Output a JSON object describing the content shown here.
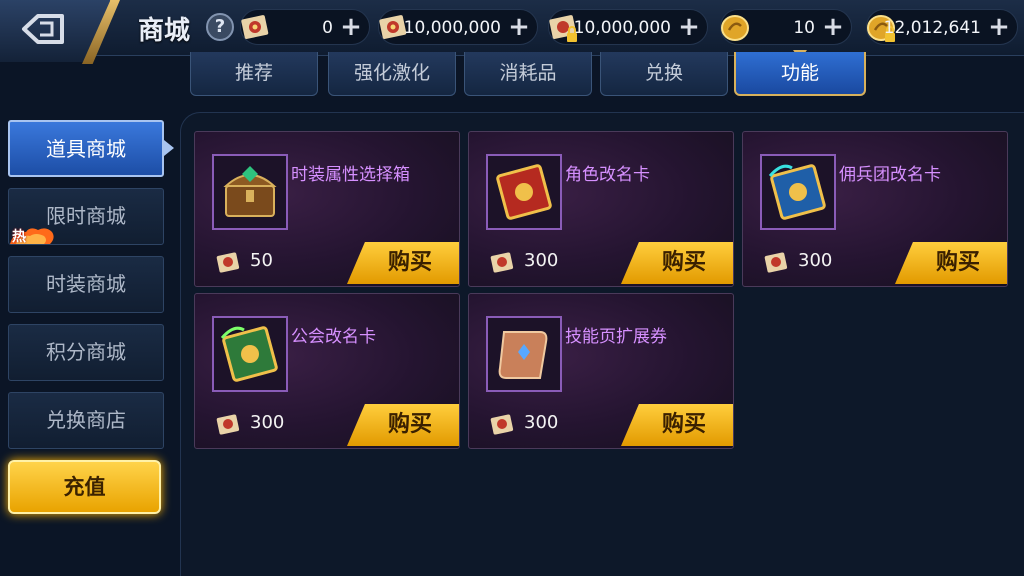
{
  "header": {
    "title": "商城",
    "help_label": "?",
    "back_icon": "back-arrow-icon"
  },
  "currencies": [
    {
      "icon": "scroll-ticket-icon",
      "amount": "0",
      "plus": "+"
    },
    {
      "icon": "scroll-ticket-icon",
      "amount": "10,000,000",
      "plus": "+"
    },
    {
      "icon": "locked-scroll-ticket-icon",
      "amount": "10,000,000",
      "plus": "+"
    },
    {
      "icon": "gold-coin-icon",
      "amount": "10",
      "plus": "+"
    },
    {
      "icon": "locked-gold-coin-icon",
      "amount": "12,012,641",
      "plus": "+"
    }
  ],
  "tabs": [
    {
      "label": "推荐",
      "active": false
    },
    {
      "label": "强化激化",
      "active": false
    },
    {
      "label": "消耗品",
      "active": false
    },
    {
      "label": "兑换",
      "active": false
    },
    {
      "label": "功能",
      "active": true
    }
  ],
  "sidebar": {
    "items": [
      {
        "label": "道具商城",
        "active": true
      },
      {
        "label": "限时商城",
        "active": false,
        "badge": "热"
      },
      {
        "label": "时装商城",
        "active": false
      },
      {
        "label": "积分商城",
        "active": false
      },
      {
        "label": "兑换商店",
        "active": false
      }
    ],
    "recharge_label": "充值"
  },
  "items": [
    {
      "name": "时装属性选择箱",
      "price": "50",
      "buy_label": "购买",
      "icon": "treasure-chest-icon"
    },
    {
      "name": "角色改名卡",
      "price": "300",
      "buy_label": "购买",
      "icon": "red-rename-card-icon"
    },
    {
      "name": "佣兵团改名卡",
      "price": "300",
      "buy_label": "购买",
      "icon": "blue-rename-card-icon"
    },
    {
      "name": "公会改名卡",
      "price": "300",
      "buy_label": "购买",
      "icon": "green-rename-card-icon"
    },
    {
      "name": "技能页扩展券",
      "price": "300",
      "buy_label": "购买",
      "icon": "scroll-icon"
    }
  ],
  "colors": {
    "accent_gold": "#e9a300",
    "active_blue": "#2f6fd3",
    "item_name_purple": "#d690ff",
    "background": "#0b1526"
  }
}
